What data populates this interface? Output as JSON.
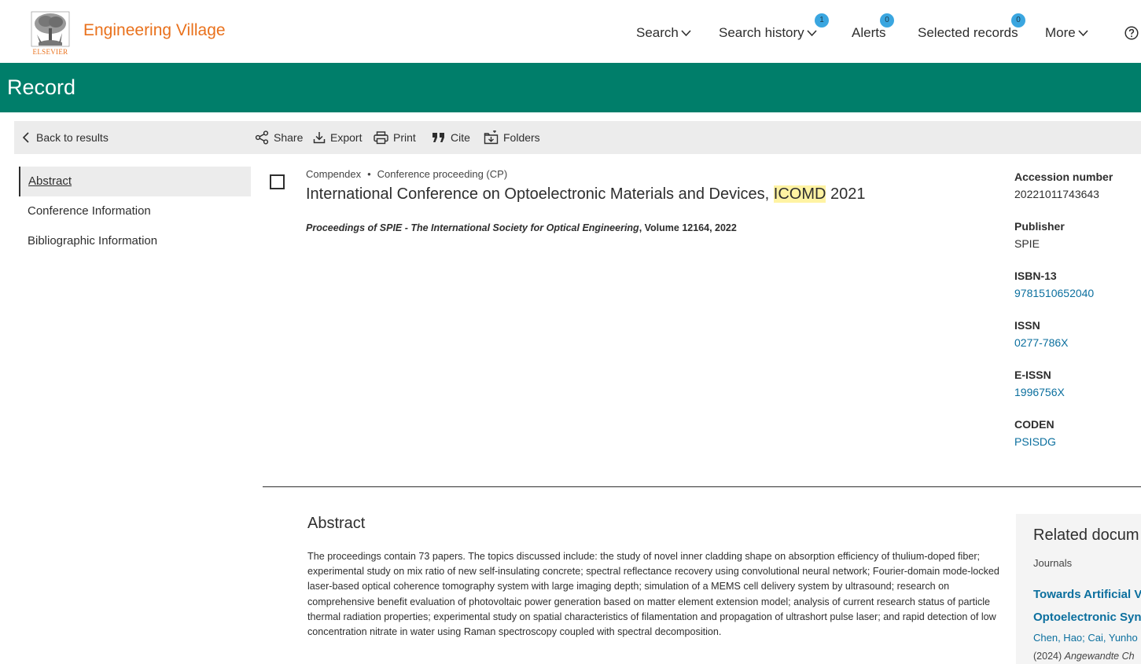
{
  "header": {
    "publisher_logo_text": "ELSEVIER",
    "brand": "Engineering Village",
    "nav": {
      "search": "Search",
      "search_history": "Search history",
      "search_history_badge": "1",
      "alerts": "Alerts",
      "alerts_badge": "0",
      "selected_records": "Selected records",
      "selected_records_badge": "0",
      "more": "More"
    }
  },
  "page": {
    "title": "Record"
  },
  "toolbar": {
    "back": "Back to results",
    "share": "Share",
    "export": "Export",
    "print": "Print",
    "cite": "Cite",
    "folders": "Folders"
  },
  "left_nav": [
    {
      "label": "Abstract"
    },
    {
      "label": "Conference Information"
    },
    {
      "label": "Bibliographic Information"
    }
  ],
  "record": {
    "database": "Compendex",
    "separator": "•",
    "doc_type": "Conference proceeding (CP)",
    "title_before": "International Conference on Optoelectronic Materials and Devices, ",
    "title_highlight": "ICOMD",
    "title_after": " 2021",
    "source_italic": "Proceedings of SPIE - The International Society for Optical Engineering",
    "source_rest": ", Volume 12164, 2022"
  },
  "details": [
    {
      "label": "Accession number",
      "value": "20221011743643",
      "link": false
    },
    {
      "label": "Publisher",
      "value": "SPIE",
      "link": false
    },
    {
      "label": "ISBN-13",
      "value": "9781510652040",
      "link": true
    },
    {
      "label": "ISSN",
      "value": "0277-786X",
      "link": true
    },
    {
      "label": "E-ISSN",
      "value": "1996756X",
      "link": true
    },
    {
      "label": "CODEN",
      "value": "PSISDG",
      "link": true
    }
  ],
  "abstract": {
    "heading": "Abstract",
    "text": "The proceedings contain 73 papers. The topics discussed include: the study of novel inner cladding shape on absorption efficiency of thulium-doped fiber; experimental study on mix ratio of new self-insulating concrete; spectral reflectance recovery using convolutional neural network; Fourier-domain mode-locked laser-based optical coherence tomography system with large imaging depth; simulation of a MEMS cell delivery system by ultrasound; research on comprehensive benefit evaluation of photovoltaic power generation based on matter element extension model; analysis of current research status of particle thermal radiation properties; experimental study on spatial characteristics of filamentation and propagation of ultrashort pulse laser; and rapid detection of low concentration nitrate in water using Raman spectroscopy coupled with spectral decomposition."
  },
  "related": {
    "heading": "Related docum",
    "category": "Journals",
    "title_line1": "Towards Artificial V",
    "title_line2": "Optoelectronic Syna",
    "authors": "Chen, Hao; Cai, Yunho",
    "year": "(2024)",
    "journal": "Angewandte Ch"
  }
}
